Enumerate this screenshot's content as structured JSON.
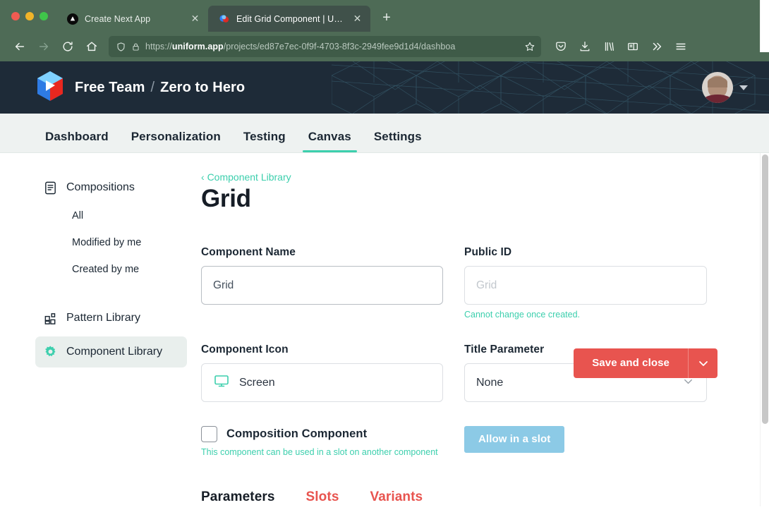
{
  "browser": {
    "tabs": [
      {
        "title": "Create Next App",
        "favicon": "nextjs-icon",
        "active": false
      },
      {
        "title": "Edit Grid Component | Uniform",
        "favicon": "uniform-icon",
        "active": true
      }
    ],
    "new_tab_label": "+",
    "close_label": "✕",
    "nav": {
      "back": "back-arrow-icon",
      "forward": "forward-arrow-icon",
      "reload": "reload-icon",
      "home": "home-icon"
    },
    "url": {
      "protocol": "https://",
      "domain": "uniform.app",
      "path": "/projects/ed87e7ec-0f9f-4703-8f3c-2949fee9d1d4/dashboa",
      "shield_icon": "shield-icon",
      "lock_icon": "lock-icon",
      "bookmark_icon": "star-icon"
    },
    "toolbar_icons": [
      "pocket-icon",
      "downloads-icon",
      "library-icon",
      "sidebar-icon",
      "overflow-icon",
      "app-menu-icon"
    ]
  },
  "header": {
    "logo": "uniform-logo",
    "team": "Free Team",
    "separator": "/",
    "project": "Zero to Hero",
    "avatar": "user-avatar",
    "caret": "chevron-down-icon"
  },
  "main_nav": {
    "items": [
      {
        "label": "Dashboard",
        "active": false
      },
      {
        "label": "Personalization",
        "active": false
      },
      {
        "label": "Testing",
        "active": false
      },
      {
        "label": "Canvas",
        "active": true
      },
      {
        "label": "Settings",
        "active": false
      }
    ]
  },
  "sidebar": {
    "compositions": {
      "label": "Compositions",
      "icon": "document-icon"
    },
    "sub_items": [
      {
        "label": "All"
      },
      {
        "label": "Modified by me"
      },
      {
        "label": "Created by me"
      }
    ],
    "items": [
      {
        "label": "Pattern Library",
        "icon": "pattern-icon",
        "active": false
      },
      {
        "label": "Component Library",
        "icon": "gear-icon",
        "active": true
      }
    ]
  },
  "main": {
    "breadcrumb": "Component Library",
    "breadcrumb_chevron": "‹",
    "title": "Grid",
    "save_button": "Save and close",
    "save_caret": "chevron-down-icon",
    "fields": {
      "component_name": {
        "label": "Component Name",
        "value": "Grid"
      },
      "public_id": {
        "label": "Public ID",
        "placeholder": "Grid",
        "helper": "Cannot change once created."
      },
      "component_icon": {
        "label": "Component Icon",
        "value": "Screen",
        "icon": "screen-icon"
      },
      "title_parameter": {
        "label": "Title Parameter",
        "value": "None",
        "caret": "chevron-down-icon"
      },
      "composition_component": {
        "label": "Composition Component",
        "checked": false,
        "helper": "This component can be used in a slot on another component"
      },
      "allow_in_slot": {
        "label": "Allow in a slot"
      }
    },
    "bottom_tabs": [
      {
        "label": "Parameters",
        "active": true
      },
      {
        "label": "Slots",
        "active": false
      },
      {
        "label": "Variants",
        "active": false
      }
    ]
  },
  "colors": {
    "browser_chrome": "#4e6b56",
    "app_header": "#1e2b38",
    "accent_teal": "#3ccfad",
    "accent_red": "#e8544f",
    "accent_blue": "#8ccae6"
  }
}
